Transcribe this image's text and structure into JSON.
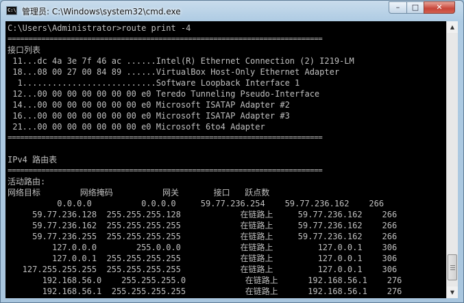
{
  "window": {
    "title": "管理员: C:\\Windows\\system32\\cmd.exe",
    "icon_label": "C:\\",
    "minimize_glyph": "–",
    "maximize_glyph": "□",
    "close_glyph": "✕"
  },
  "console": {
    "lines": [
      "C:\\Users\\Administrator>route print -4",
      "===========================================================================",
      "接口列表",
      " 11...dc 4a 3e 7f 46 ac ......Intel(R) Ethernet Connection (2) I219-LM",
      " 18...08 00 27 00 84 89 ......VirtualBox Host-Only Ethernet Adapter",
      "  1...........................Software Loopback Interface 1",
      " 12...00 00 00 00 00 00 00 e0 Teredo Tunneling Pseudo-Interface",
      " 14...00 00 00 00 00 00 00 e0 Microsoft ISATAP Adapter #2",
      " 16...00 00 00 00 00 00 00 e0 Microsoft ISATAP Adapter #3",
      " 21...00 00 00 00 00 00 00 e0 Microsoft 6to4 Adapter",
      "===========================================================================",
      "",
      "IPv4 路由表",
      "===========================================================================",
      "活动路由:",
      "网络目标        网络掩码          网关       接口   跃点数",
      "          0.0.0.0          0.0.0.0     59.77.236.254    59.77.236.162    266",
      "     59.77.236.128  255.255.255.128            在链路上     59.77.236.162    266",
      "     59.77.236.162  255.255.255.255            在链路上     59.77.236.162    266",
      "     59.77.236.255  255.255.255.255            在链路上     59.77.236.162    266",
      "         127.0.0.0        255.0.0.0            在链路上         127.0.0.1    306",
      "         127.0.0.1  255.255.255.255            在链路上         127.0.0.1    306",
      "   127.255.255.255  255.255.255.255            在链路上         127.0.0.1    306",
      "       192.168.56.0    255.255.255.0            在链路上      192.168.56.1    276",
      "       192.168.56.1  255.255.255.255            在链路上      192.168.56.1    276"
    ]
  },
  "scrollbar": {
    "up_glyph": "▲",
    "down_glyph": "▼"
  }
}
